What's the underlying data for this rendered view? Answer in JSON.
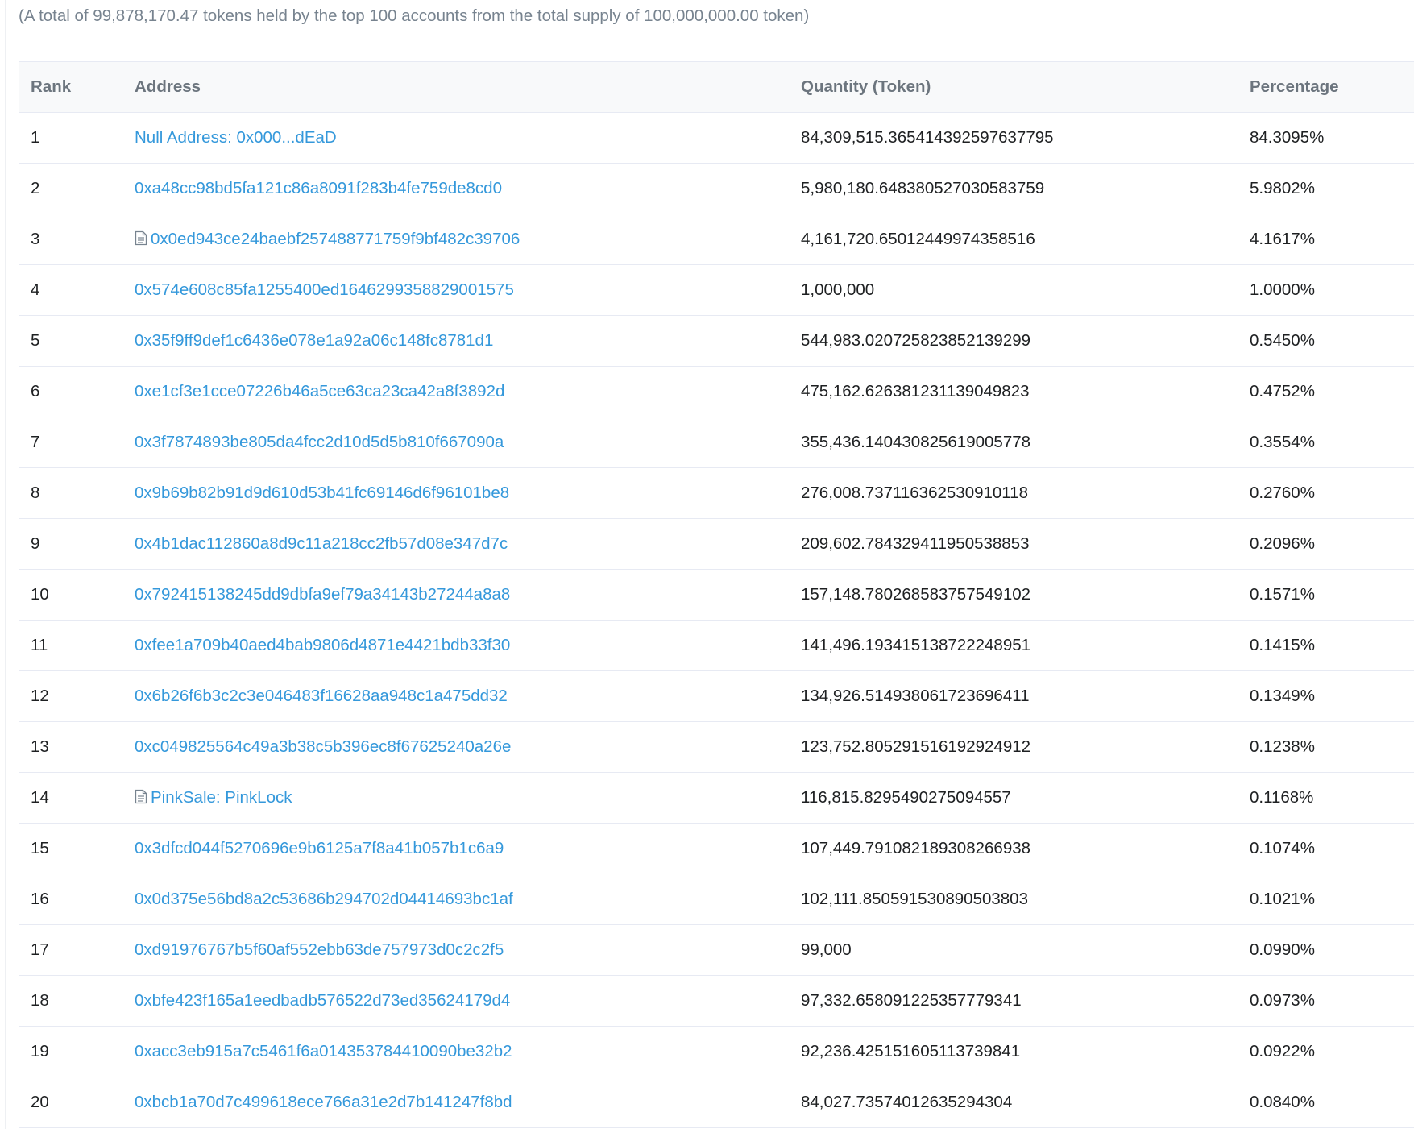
{
  "summary_text": "(A total of 99,878,170.47 tokens held by the top 100 accounts from the total supply of 100,000,000.00 token)",
  "table": {
    "headers": {
      "rank": "Rank",
      "address": "Address",
      "quantity": "Quantity (Token)",
      "percentage": "Percentage"
    },
    "rows": [
      {
        "rank": "1",
        "address": "Null Address: 0x000...dEaD",
        "contract": false,
        "quantity": "84,309,515.365414392597637795",
        "percentage": "84.3095%"
      },
      {
        "rank": "2",
        "address": "0xa48cc98bd5fa121c86a8091f283b4fe759de8cd0",
        "contract": false,
        "quantity": "5,980,180.648380527030583759",
        "percentage": "5.9802%"
      },
      {
        "rank": "3",
        "address": "0x0ed943ce24baebf257488771759f9bf482c39706",
        "contract": true,
        "quantity": "4,161,720.65012449974358516",
        "percentage": "4.1617%"
      },
      {
        "rank": "4",
        "address": "0x574e608c85fa1255400ed1646299358829001575",
        "contract": false,
        "quantity": "1,000,000",
        "percentage": "1.0000%"
      },
      {
        "rank": "5",
        "address": "0x35f9ff9def1c6436e078e1a92a06c148fc8781d1",
        "contract": false,
        "quantity": "544,983.020725823852139299",
        "percentage": "0.5450%"
      },
      {
        "rank": "6",
        "address": "0xe1cf3e1cce07226b46a5ce63ca23ca42a8f3892d",
        "contract": false,
        "quantity": "475,162.626381231139049823",
        "percentage": "0.4752%"
      },
      {
        "rank": "7",
        "address": "0x3f7874893be805da4fcc2d10d5d5b810f667090a",
        "contract": false,
        "quantity": "355,436.140430825619005778",
        "percentage": "0.3554%"
      },
      {
        "rank": "8",
        "address": "0x9b69b82b91d9d610d53b41fc69146d6f96101be8",
        "contract": false,
        "quantity": "276,008.737116362530910118",
        "percentage": "0.2760%"
      },
      {
        "rank": "9",
        "address": "0x4b1dac112860a8d9c11a218cc2fb57d08e347d7c",
        "contract": false,
        "quantity": "209,602.784329411950538853",
        "percentage": "0.2096%"
      },
      {
        "rank": "10",
        "address": "0x792415138245dd9dbfa9ef79a34143b27244a8a8",
        "contract": false,
        "quantity": "157,148.780268583757549102",
        "percentage": "0.1571%"
      },
      {
        "rank": "11",
        "address": "0xfee1a709b40aed4bab9806d4871e4421bdb33f30",
        "contract": false,
        "quantity": "141,496.193415138722248951",
        "percentage": "0.1415%"
      },
      {
        "rank": "12",
        "address": "0x6b26f6b3c2c3e046483f16628aa948c1a475dd32",
        "contract": false,
        "quantity": "134,926.514938061723696411",
        "percentage": "0.1349%"
      },
      {
        "rank": "13",
        "address": "0xc049825564c49a3b38c5b396ec8f67625240a26e",
        "contract": false,
        "quantity": "123,752.805291516192924912",
        "percentage": "0.1238%"
      },
      {
        "rank": "14",
        "address": "PinkSale: PinkLock",
        "contract": true,
        "quantity": "116,815.8295490275094557",
        "percentage": "0.1168%"
      },
      {
        "rank": "15",
        "address": "0x3dfcd044f5270696e9b6125a7f8a41b057b1c6a9",
        "contract": false,
        "quantity": "107,449.791082189308266938",
        "percentage": "0.1074%"
      },
      {
        "rank": "16",
        "address": "0x0d375e56bd8a2c53686b294702d04414693bc1af",
        "contract": false,
        "quantity": "102,111.850591530890503803",
        "percentage": "0.1021%"
      },
      {
        "rank": "17",
        "address": "0xd91976767b5f60af552ebb63de757973d0c2c2f5",
        "contract": false,
        "quantity": "99,000",
        "percentage": "0.0990%"
      },
      {
        "rank": "18",
        "address": "0xbfe423f165a1eedbadb576522d73ed35624179d4",
        "contract": false,
        "quantity": "97,332.658091225357779341",
        "percentage": "0.0973%"
      },
      {
        "rank": "19",
        "address": "0xacc3eb915a7c5461f6a014353784410090be32b2",
        "contract": false,
        "quantity": "92,236.425151605113739841",
        "percentage": "0.0922%"
      },
      {
        "rank": "20",
        "address": "0xbcb1a70d7c499618ece766a31e2d7b141247f8bd",
        "contract": false,
        "quantity": "84,027.73574012635294304",
        "percentage": "0.0840%"
      }
    ]
  },
  "colors": {
    "link": "#3498db",
    "text": "#1e2022",
    "muted": "#77838f",
    "header_bg": "#f8f9fa",
    "border": "#e7eaf3"
  },
  "icons": {
    "contract": "file-contract-icon"
  }
}
